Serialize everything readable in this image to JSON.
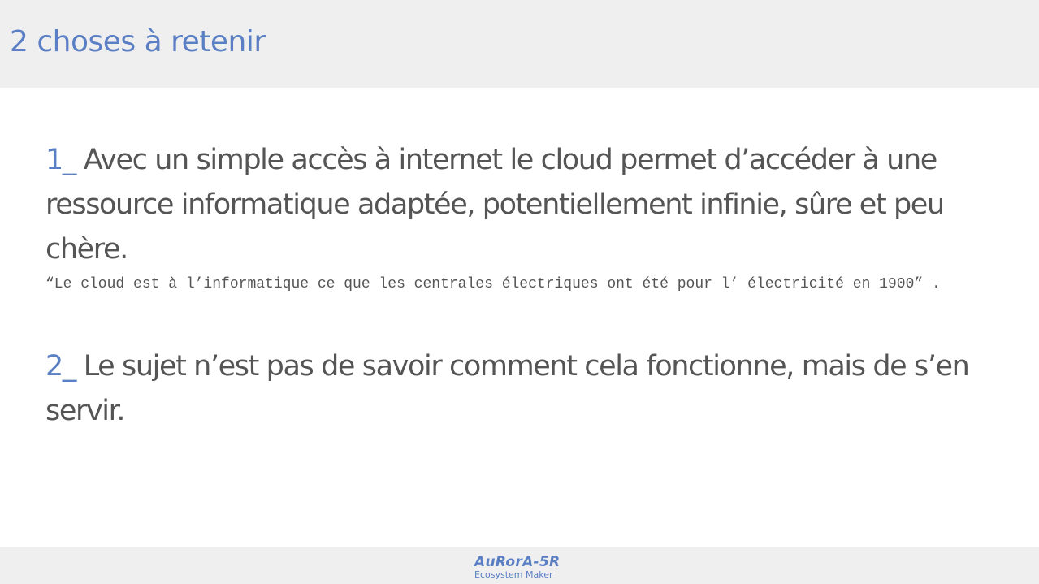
{
  "header": {
    "title": "2 choses à retenir"
  },
  "points": [
    {
      "number": "1_",
      "text": " Avec un simple accès à internet le cloud permet d’accéder à une ressource informatique adaptée, potentiellement infinie, sûre et peu chère.",
      "quote": "“Le cloud est à l’informatique ce que les centrales électriques ont été pour l’ électricité en 1900” ."
    },
    {
      "number": "2_",
      "text": " Le sujet n’est pas de savoir comment cela fonctionne, mais de s’en servir."
    }
  ],
  "footer": {
    "logo_name": "AuRorA-5R",
    "logo_tagline": "Ecosystem Maker"
  },
  "colors": {
    "accent": "#5b7fc4",
    "text": "#555555",
    "band": "#efefef"
  }
}
